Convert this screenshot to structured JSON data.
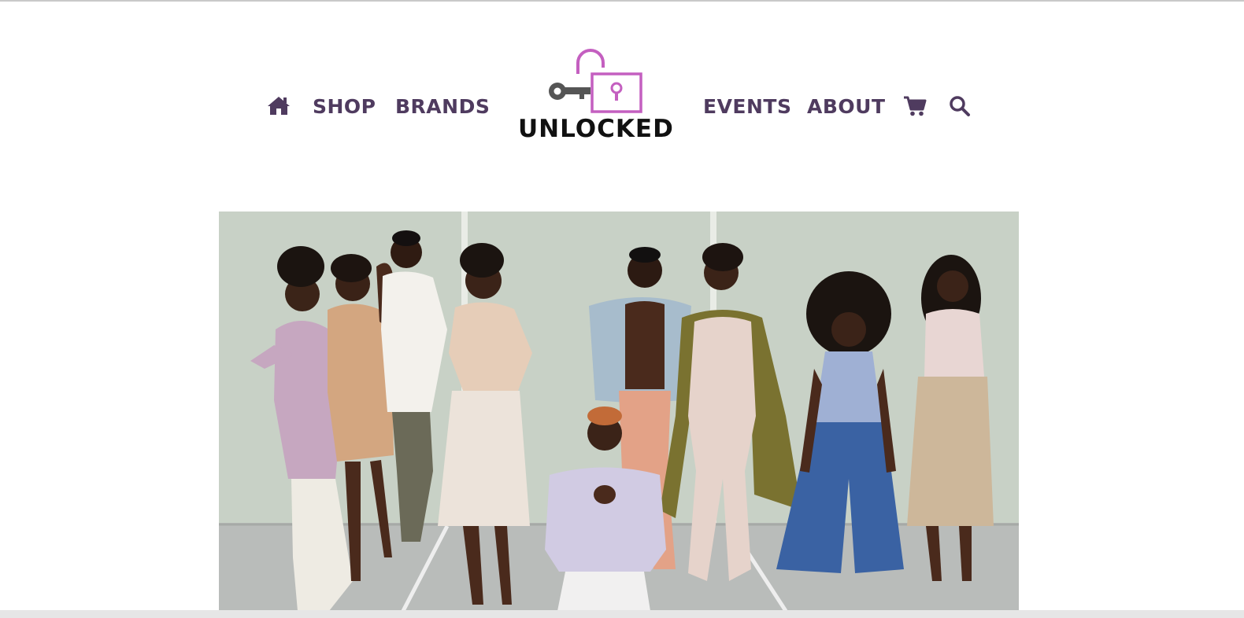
{
  "brand": {
    "name": "UNLOCKED",
    "logo_icon": "key-and-open-padlock-icon",
    "accent_color": "#c45fc0"
  },
  "nav": {
    "home_icon": "home-icon",
    "left_items": [
      {
        "label": "SHOP"
      },
      {
        "label": "BRANDS"
      }
    ],
    "right_items": [
      {
        "label": "EVENTS"
      },
      {
        "label": "ABOUT"
      }
    ],
    "cart_icon": "cart-icon",
    "search_icon": "search-icon",
    "text_color": "#4f3b5f"
  },
  "hero": {
    "image": "group-fashion-photo"
  }
}
